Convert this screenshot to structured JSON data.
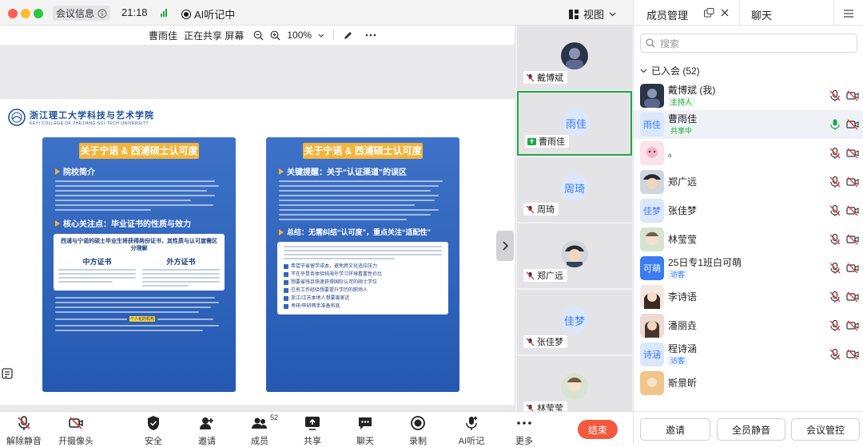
{
  "titlebar": {
    "meeting_info": "会议信息",
    "time": "21:18",
    "ai_status": "AI听记中",
    "view": "视图"
  },
  "sharebar": {
    "sharer": "曹雨佳",
    "status": "正在共享 屏幕",
    "zoom": "100%"
  },
  "document": {
    "school_name": "浙江理工大学科技与艺术学院",
    "school_en": "KEYI COLLEGE OF ZHEJIANG SCI-TECH UNIVERSITY",
    "left_panel": {
      "title": "关于宁诺 & 西浦硕士认可度",
      "sec1": "院校简介",
      "sec2": "核心关注点：毕业证书的性质与效力",
      "box_title": "西浦与宁诺的硕士毕业生将获得两份证书，其性质与认可度需区分理解",
      "col1": "中方证书",
      "col2": "外方证书",
      "highlight": "个人化的机构"
    },
    "right_panel": {
      "title": "关于宁诺 & 西浦硕士认可度",
      "sec1": "关键提醒：关于“认证渠道”的误区",
      "sec2": "总结：无需纠结“认可度”，重点关注“适配性”",
      "checks": [
        "希望节省留学成本，避免跨文化适应压力",
        "不在乎是否体验纯海外学习环境看重性价比",
        "想要省钱且快速获得国际认可的硕士学位",
        "已有工作经验想要提升学历的职场人",
        "浙江/江苏本地人想要离家近",
        "考研/申研两手准备有底"
      ]
    }
  },
  "tiles": [
    {
      "name": "戴博斌",
      "initials": "",
      "selected": false
    },
    {
      "name": "曹雨佳",
      "initials": "雨佳",
      "selected": true
    },
    {
      "name": "周琦",
      "initials": "周琦",
      "selected": false
    },
    {
      "name": "郑广远",
      "initials": "",
      "selected": false
    },
    {
      "name": "张佳梦",
      "initials": "佳梦",
      "selected": false
    },
    {
      "name": "林莹莹",
      "initials": "",
      "selected": false
    }
  ],
  "toolbar": {
    "unmute": "解除静音",
    "camera": "开摄像头",
    "security": "安全",
    "invite": "邀请",
    "members": "成员",
    "members_count": "52",
    "share": "共享",
    "chat": "聊天",
    "record": "录制",
    "ai_notes": "AI听记",
    "more": "更多",
    "end": "结束"
  },
  "right_panel": {
    "tab_members": "成员管理",
    "tab_chat": "聊天",
    "search_placeholder": "搜索",
    "joined": "已入会 (52)",
    "participants": [
      {
        "name": "戴博斌 (我)",
        "tag": "主持人",
        "initials": "",
        "mic": "muted"
      },
      {
        "name": "曹雨佳",
        "tag": "共享中",
        "initials": "雨佳",
        "mic": "on"
      },
      {
        "name": "。",
        "tag": "",
        "initials": "",
        "mic": "muted"
      },
      {
        "name": "郑广远",
        "tag": "",
        "initials": "",
        "mic": "muted"
      },
      {
        "name": "张佳梦",
        "tag": "",
        "initials": "佳梦",
        "mic": "muted"
      },
      {
        "name": "林莹莹",
        "tag": "",
        "initials": "",
        "mic": "muted"
      },
      {
        "name": "25日专1班白可萌",
        "tag": "访客",
        "initials": "可萌",
        "mic": "muted"
      },
      {
        "name": "李诗语",
        "tag": "",
        "initials": "",
        "mic": "muted"
      },
      {
        "name": "潘丽垚",
        "tag": "",
        "initials": "",
        "mic": "muted"
      },
      {
        "name": "程诗涵",
        "tag": "访客",
        "initials": "诗涵",
        "mic": "muted"
      },
      {
        "name": "斯景昕",
        "tag": "",
        "initials": "",
        "mic": "muted"
      }
    ],
    "footer": {
      "invite": "邀请",
      "mute_all": "全员静音",
      "meeting_control": "会议管控"
    }
  },
  "colors": {
    "accent": "#3b7cf0",
    "green": "#22a447",
    "red": "#f5583d",
    "panel_blue": "#2f64c3",
    "panel_gold": "#f4b43a"
  }
}
